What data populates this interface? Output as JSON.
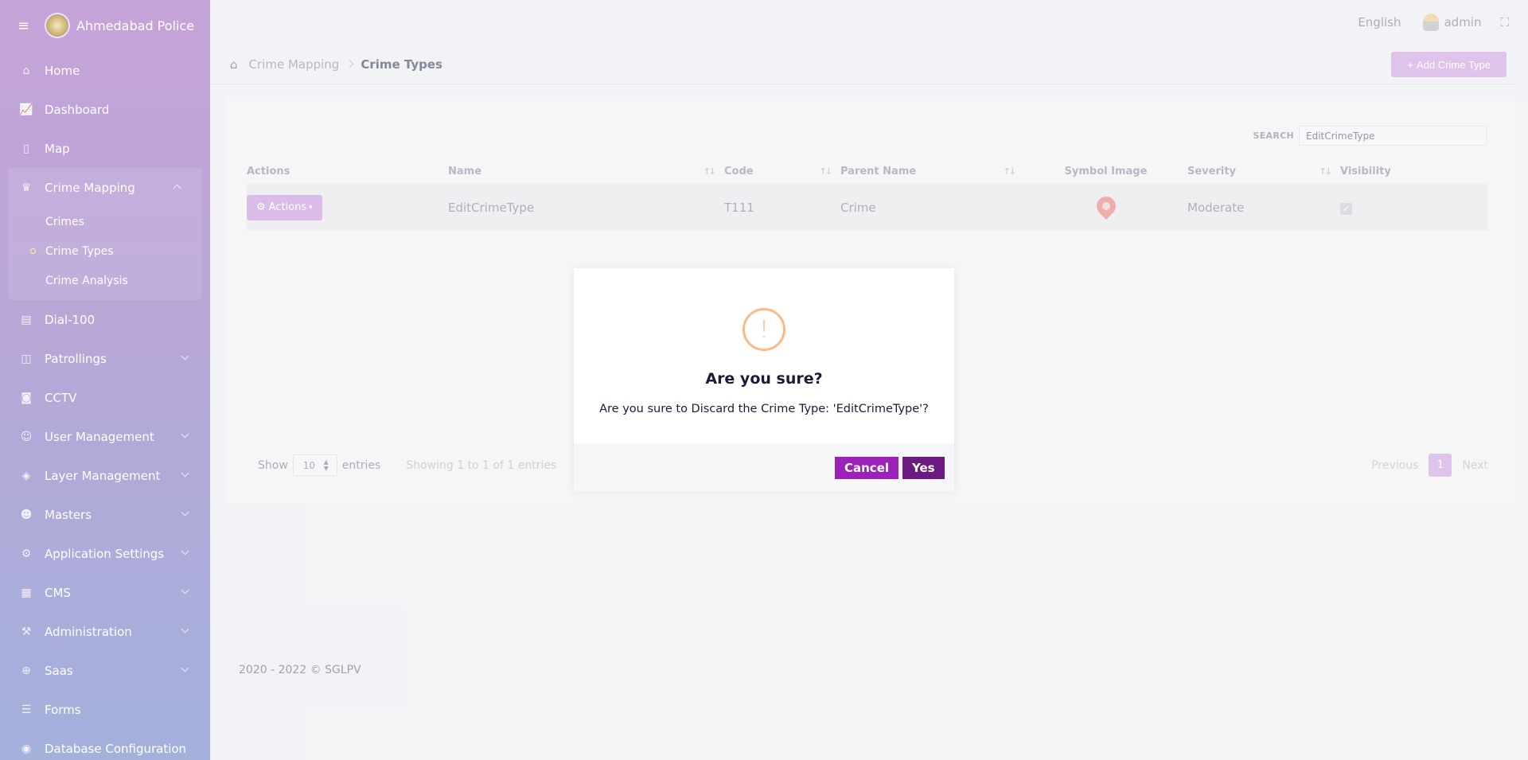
{
  "sidebar": {
    "brand": "Ahmedabad Police",
    "items": [
      {
        "label": "Home"
      },
      {
        "label": "Dashboard"
      },
      {
        "label": "Map"
      },
      {
        "label": "Crime Mapping"
      },
      {
        "label": "Dial-100"
      },
      {
        "label": "Patrollings"
      },
      {
        "label": "CCTV"
      },
      {
        "label": "User Management"
      },
      {
        "label": "Layer Management"
      },
      {
        "label": "Masters"
      },
      {
        "label": "Application Settings"
      },
      {
        "label": "CMS"
      },
      {
        "label": "Administration"
      },
      {
        "label": "Saas"
      },
      {
        "label": "Forms"
      },
      {
        "label": "Database Configuration"
      }
    ],
    "sub_items": [
      {
        "label": "Crimes"
      },
      {
        "label": "Crime Types"
      },
      {
        "label": "Crime Analysis"
      }
    ]
  },
  "topbar": {
    "language": "English",
    "username": "admin"
  },
  "breadcrumb": {
    "parent": "Crime Mapping",
    "current": "Crime Types"
  },
  "add_button": "Add Crime Type",
  "search": {
    "label": "SEARCH",
    "value": "EditCrimeType"
  },
  "table": {
    "headers": [
      "Actions",
      "Name",
      "Code",
      "Parent Name",
      "Symbol Image",
      "Severity",
      "Visibility"
    ],
    "rows": [
      {
        "actions": "Actions",
        "name": "EditCrimeType",
        "code": "T111",
        "parent": "Crime",
        "severity": "Moderate"
      }
    ]
  },
  "pagination": {
    "show": "Show",
    "page_size": "10",
    "entries": "entries",
    "info": "Showing 1 to 1 of 1 entries",
    "previous": "Previous",
    "page": "1",
    "next": "Next"
  },
  "footer": "2020 - 2022 © SGLPV",
  "modal": {
    "title": "Are you sure?",
    "text": "Are you sure to Discard the Crime Type: 'EditCrimeType'?",
    "cancel": "Cancel",
    "yes": "Yes"
  },
  "colors": {
    "accent": "#9b21b8",
    "accent_dark": "#6a1a80",
    "warning": "#f8bb86"
  }
}
